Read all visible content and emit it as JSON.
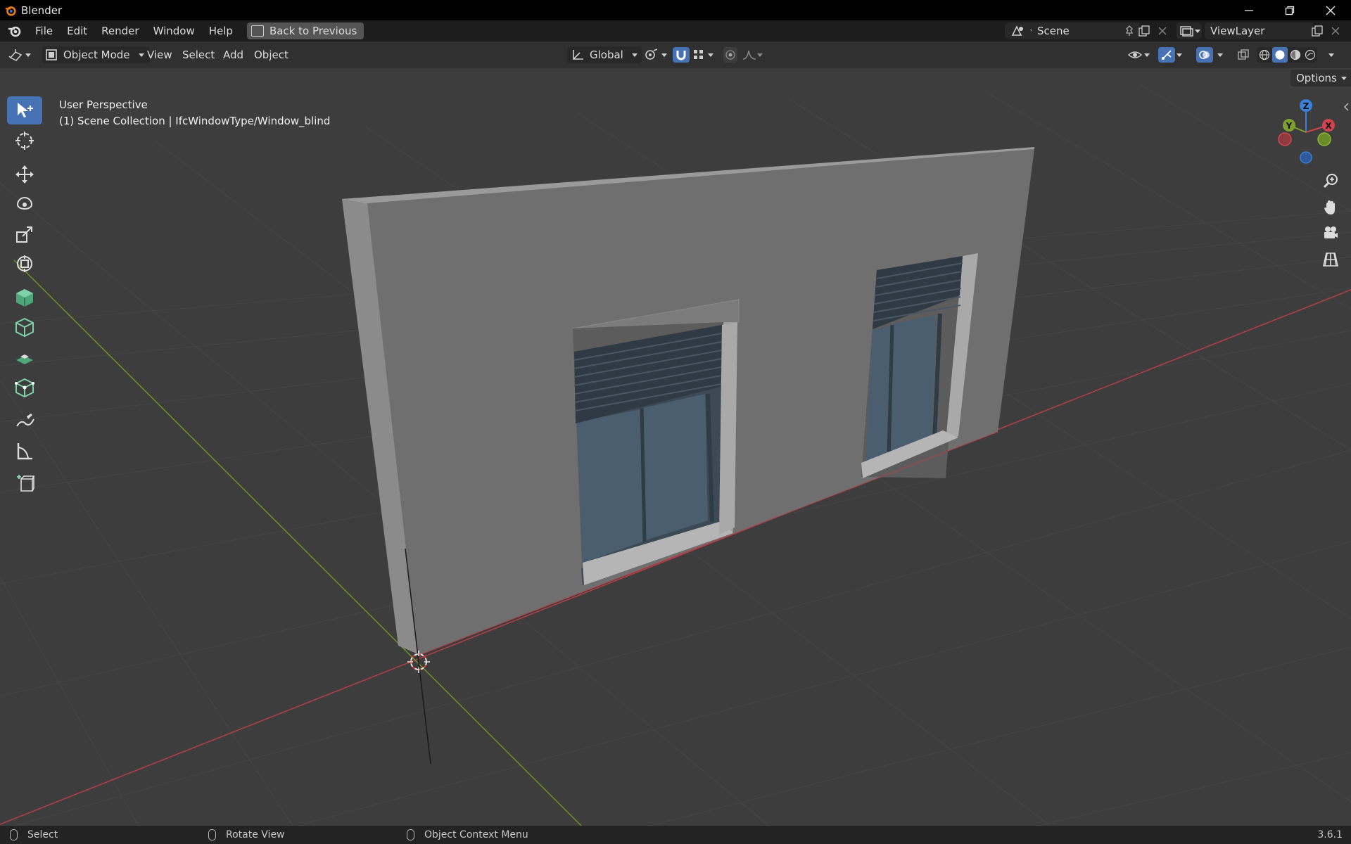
{
  "window": {
    "title": "Blender",
    "controls": [
      "minimize",
      "restore",
      "close"
    ]
  },
  "menubar": {
    "items": [
      "File",
      "Edit",
      "Render",
      "Window",
      "Help"
    ],
    "back_button": "Back to Previous",
    "scene_field": "Scene",
    "view_layer_field": "ViewLayer"
  },
  "viewport_header": {
    "mode": "Object Mode",
    "menus": [
      "View",
      "Select",
      "Add",
      "Object"
    ],
    "transform_orientation": "Global",
    "options_label": "Options"
  },
  "viewport": {
    "perspective_label": "User Perspective",
    "collection_label": "(1) Scene Collection | IfcWindowType/Window_blind",
    "gizmo_axes": [
      "Z",
      "Y",
      "X"
    ]
  },
  "toolbar": {
    "tools": [
      "select-box",
      "cursor",
      "move",
      "rotate",
      "scale",
      "transform",
      "add-cube",
      "add-cube-wire",
      "extrude",
      "add-mesh",
      "annotate",
      "measure",
      "add-object"
    ]
  },
  "statusbar": {
    "select": "Select",
    "rotate": "Rotate View",
    "context": "Object Context Menu",
    "version": "3.6.1"
  },
  "colors": {
    "accent": "#4772b3",
    "wall": "#777777",
    "glass": "#4a5e6f",
    "x_axis": "#d1434f",
    "y_axis": "#7da12e",
    "z_axis": "#3b80d9"
  }
}
